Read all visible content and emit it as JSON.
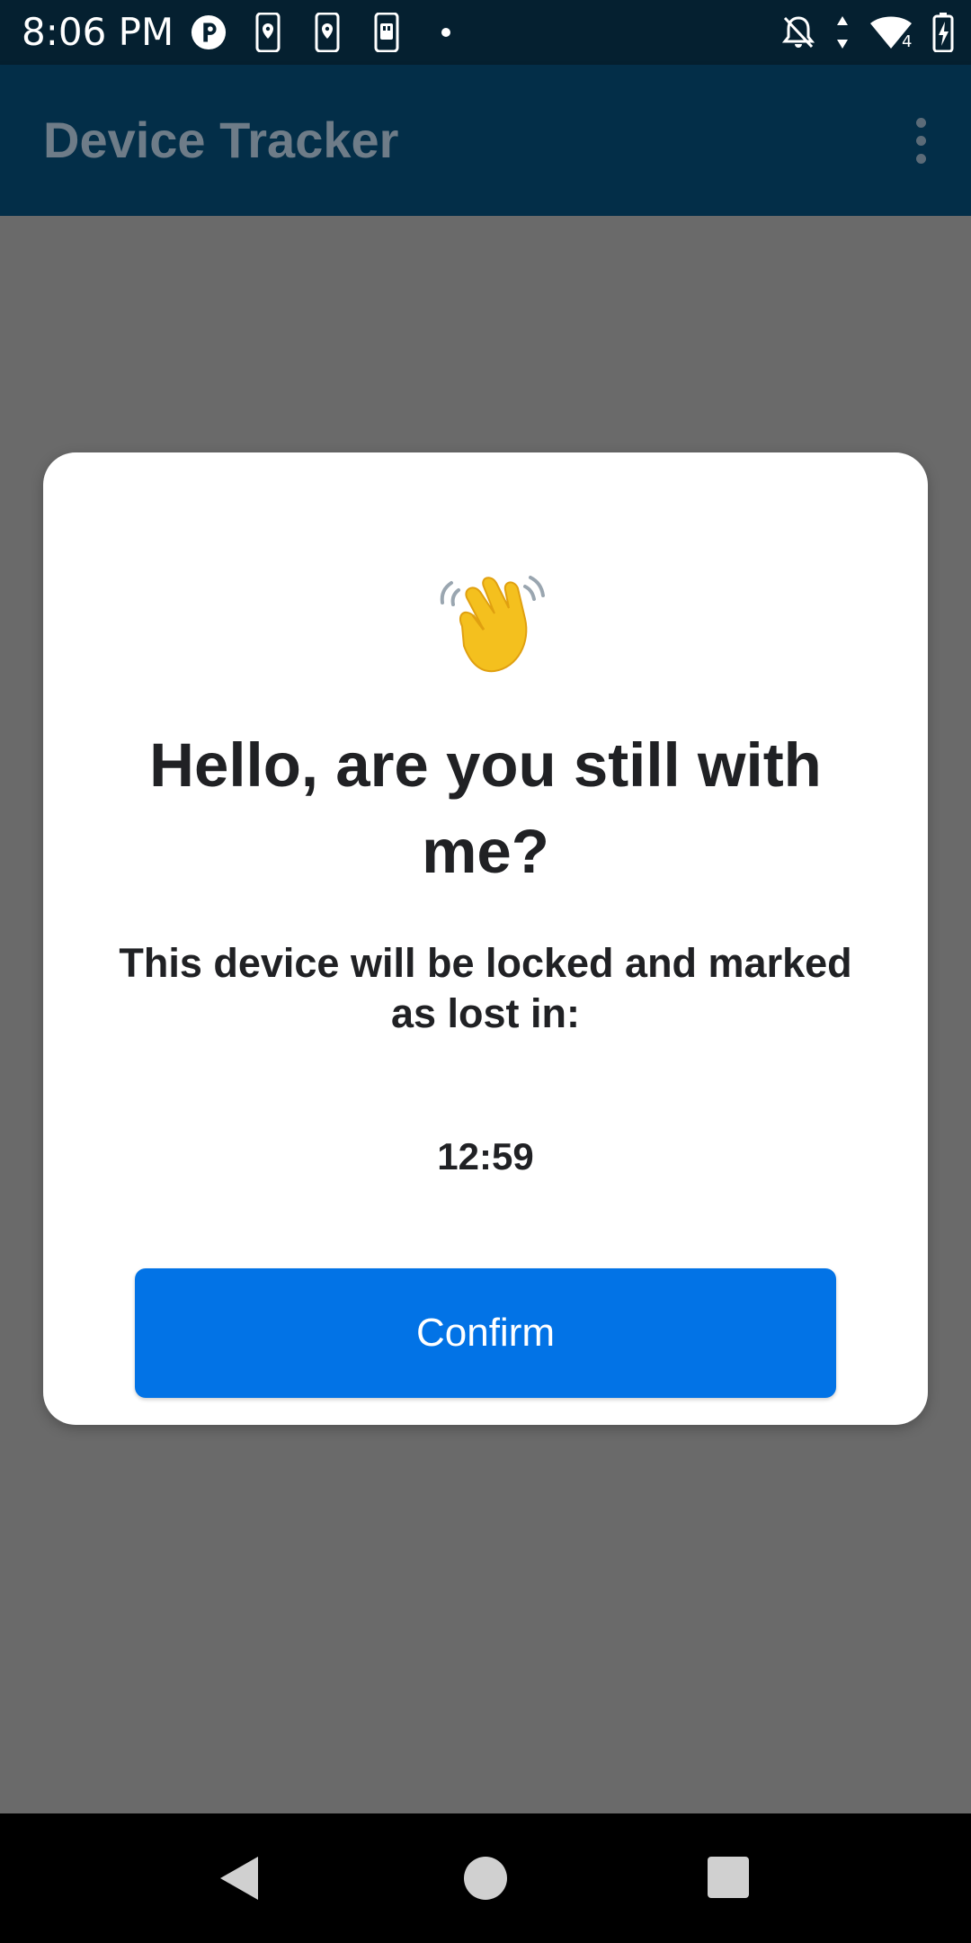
{
  "status_bar": {
    "time": "8:06 PM",
    "battery_level": "4",
    "left_icons": [
      "circle-p-icon",
      "phone-location-icon",
      "phone-location-icon",
      "phone-sd-icon",
      "dot-icon"
    ],
    "right_icons": [
      "notifications-off-icon",
      "data-arrows-icon",
      "wifi-icon",
      "battery-charging-icon"
    ]
  },
  "app_bar": {
    "title": "Device Tracker",
    "menu_icon": "more-vert-icon"
  },
  "dialog": {
    "emoji": "waving-hand-icon",
    "title": "Hello, are you still with me?",
    "message": "This device will be locked and marked as lost in:",
    "countdown": "12:59",
    "confirm_label": "Confirm"
  },
  "navigation": {
    "back_icon": "back-triangle-icon",
    "home_icon": "home-circle-icon",
    "recents_icon": "recents-square-icon"
  },
  "colors": {
    "status_bar": "#052030",
    "app_bar": "#032e48",
    "scrim": "#6a6a6a",
    "accent": "#0273e6",
    "text": "#202124"
  }
}
